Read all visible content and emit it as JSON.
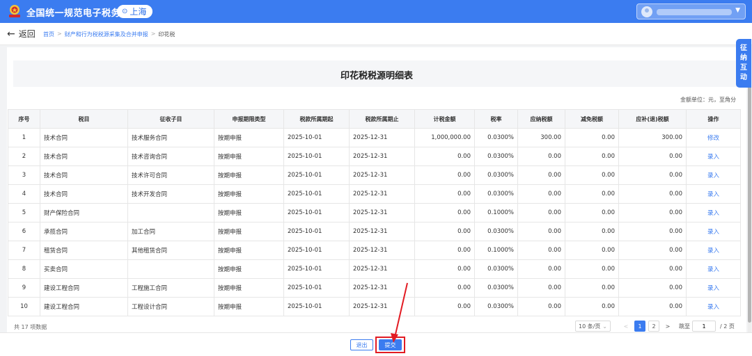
{
  "header": {
    "title": "全国统一规范电子税务局",
    "region": "上海"
  },
  "breadcrumb": {
    "back_label": "返回",
    "items": [
      "首页",
      "财产和行为税税源采集及合并申报",
      "印花税"
    ],
    "separator": ">"
  },
  "page": {
    "title": "印花税税源明细表",
    "unit_note": "金额单位：元，至角分"
  },
  "table": {
    "headers": [
      "序号",
      "税目",
      "征收子目",
      "申报期限类型",
      "税款所属期起",
      "税款所属期止",
      "计税金额",
      "税率",
      "应纳税额",
      "减免税额",
      "应补(退)税额",
      "操作"
    ],
    "rows": [
      [
        "1",
        "技术合同",
        "技术服务合同",
        "按期申报",
        "2025-10-01",
        "2025-12-31",
        "1,000,000.00",
        "0.0300%",
        "300.00",
        "0.00",
        "300.00",
        "修改"
      ],
      [
        "2",
        "技术合同",
        "技术咨询合同",
        "按期申报",
        "2025-10-01",
        "2025-12-31",
        "0.00",
        "0.0300%",
        "0.00",
        "0.00",
        "0.00",
        "录入"
      ],
      [
        "3",
        "技术合同",
        "技术许可合同",
        "按期申报",
        "2025-10-01",
        "2025-12-31",
        "0.00",
        "0.0300%",
        "0.00",
        "0.00",
        "0.00",
        "录入"
      ],
      [
        "4",
        "技术合同",
        "技术开发合同",
        "按期申报",
        "2025-10-01",
        "2025-12-31",
        "0.00",
        "0.0300%",
        "0.00",
        "0.00",
        "0.00",
        "录入"
      ],
      [
        "5",
        "财产保险合同",
        "",
        "按期申报",
        "2025-10-01",
        "2025-12-31",
        "0.00",
        "0.1000%",
        "0.00",
        "0.00",
        "0.00",
        "录入"
      ],
      [
        "6",
        "承揽合同",
        "加工合同",
        "按期申报",
        "2025-10-01",
        "2025-12-31",
        "0.00",
        "0.0300%",
        "0.00",
        "0.00",
        "0.00",
        "录入"
      ],
      [
        "7",
        "租赁合同",
        "其他租赁合同",
        "按期申报",
        "2025-10-01",
        "2025-12-31",
        "0.00",
        "0.1000%",
        "0.00",
        "0.00",
        "0.00",
        "录入"
      ],
      [
        "8",
        "买卖合同",
        "",
        "按期申报",
        "2025-10-01",
        "2025-12-31",
        "0.00",
        "0.0300%",
        "0.00",
        "0.00",
        "0.00",
        "录入"
      ],
      [
        "9",
        "建设工程合同",
        "工程施工合同",
        "按期申报",
        "2025-10-01",
        "2025-12-31",
        "0.00",
        "0.0300%",
        "0.00",
        "0.00",
        "0.00",
        "录入"
      ],
      [
        "10",
        "建设工程合同",
        "工程设计合同",
        "按期申报",
        "2025-10-01",
        "2025-12-31",
        "0.00",
        "0.0300%",
        "0.00",
        "0.00",
        "0.00",
        "录入"
      ]
    ]
  },
  "pagination": {
    "total_text": "共 17 项数据",
    "page_size": "10 条/页",
    "pages": [
      "1",
      "2"
    ],
    "current_page": "1",
    "prev": "<",
    "next": ">",
    "goto_label": "跳至",
    "goto_value": "1",
    "page_count": "/ 2 页"
  },
  "side_tab": {
    "chars": [
      "征",
      "纳",
      "互",
      "动"
    ]
  },
  "footer": {
    "exit_label": "退出",
    "submit_label": "提交"
  },
  "colors": {
    "primary": "#3b7cf0",
    "highlight": "#e21b23"
  },
  "icons": {
    "emblem": "tax-emblem-icon",
    "location": "location-pin-icon",
    "back": "arrow-left-icon",
    "user_menu": "chevron-down-icon"
  }
}
